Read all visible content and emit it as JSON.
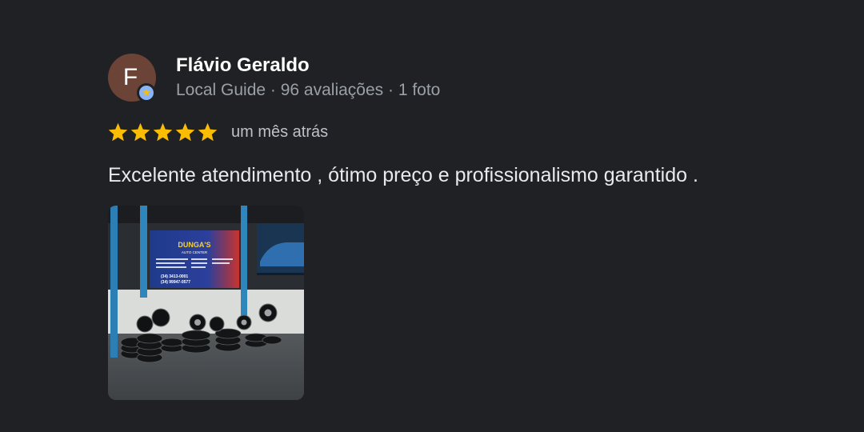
{
  "reviewer": {
    "initial": "F",
    "name": "Flávio Geraldo",
    "meta": "Local Guide · 96 avaliações · 1 foto",
    "avatar_color": "#6b4437",
    "badge_icon": "local-guide-star-icon"
  },
  "rating": {
    "stars": 5,
    "max": 5,
    "star_color": "#fbbc04",
    "date": "um mês atrás"
  },
  "review": {
    "text": "Excelente atendimento , ótimo preço e profissionalismo garantido ."
  },
  "photo": {
    "sign_title": "DUNGA'S",
    "sign_subtitle": "AUTO CENTER",
    "sign_phone_1": "(34) 3413-0001",
    "sign_phone_2": "(34) 99947-0577"
  },
  "colors": {
    "background": "#202124",
    "name_text": "#ffffff",
    "meta_text": "#9aa0a6",
    "body_text": "#e8eaed"
  }
}
